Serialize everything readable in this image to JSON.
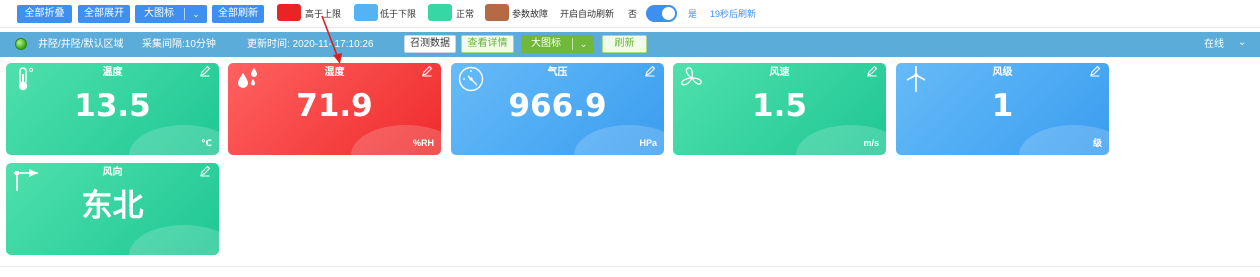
{
  "toolbar": {
    "collapse_all": "全部折叠",
    "expand_all": "全部展开",
    "view_mode": "大图标",
    "refresh_all": "全部刷新",
    "legend": [
      {
        "label": "高于上限",
        "color": "#e82424"
      },
      {
        "label": "低于下限",
        "color": "#55b3f3"
      },
      {
        "label": "正常",
        "color": "#37d6a5"
      },
      {
        "label": "参数故障",
        "color": "#b56a45"
      }
    ],
    "auto_refresh_label": "开启自动刷新",
    "no_label": "否",
    "yes_label": "是",
    "countdown": "19秒后刷新"
  },
  "infobar": {
    "location": "井陉/井陉/默认区域",
    "interval": "采集间隔:10分钟",
    "updated": "更新时间: 2020-11-   17:10:26",
    "summon_btn": "召测数据",
    "detail_btn": "查看详情",
    "view_mode": "大图标",
    "refresh_btn": "刷新",
    "status": "在线"
  },
  "cards": [
    {
      "title": "温度",
      "value": "13.5",
      "unit": "℃",
      "icon": "thermometer-icon",
      "state": "normal"
    },
    {
      "title": "湿度",
      "value": "71.9",
      "unit": "%RH",
      "icon": "water-drops-icon",
      "state": "above"
    },
    {
      "title": "气压",
      "value": "966.9",
      "unit": "HPa",
      "icon": "pressure-gauge-icon",
      "state": "below"
    },
    {
      "title": "风速",
      "value": "1.5",
      "unit": "m/s",
      "icon": "fan-icon",
      "state": "normal"
    },
    {
      "title": "风级",
      "value": "1",
      "unit": "级",
      "icon": "wind-turbine-icon",
      "state": "below"
    },
    {
      "title": "风向",
      "value": "东北",
      "unit": "",
      "icon": "wind-vane-icon",
      "state": "normal"
    }
  ],
  "colors": {
    "accent": "#3d8ff0",
    "above": "#ef2b2b",
    "below": "#3a9df0",
    "normal": "#1ec793",
    "infobar": "#5bacd8"
  },
  "annotation": "red-arrow-pointing-to-humidity-card"
}
